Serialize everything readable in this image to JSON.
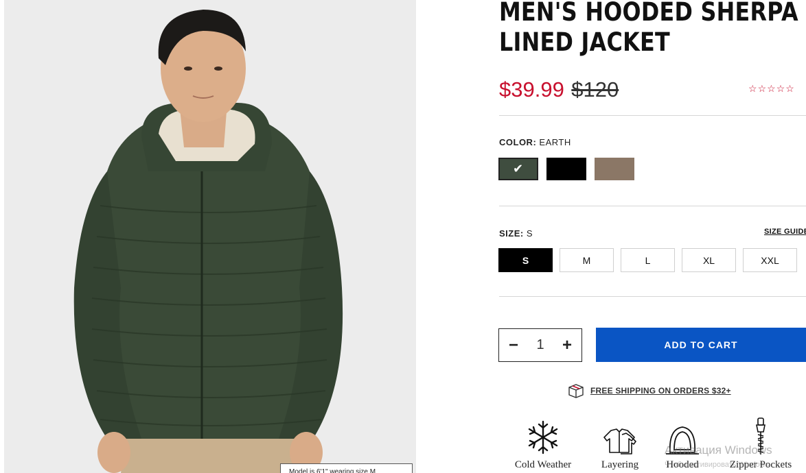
{
  "product": {
    "title": "MEN'S HOODED SHERPA LINED JACKET",
    "title_line1": "MEN'S HOODED SHERPA",
    "title_line2": "LINED JACKET",
    "price_sale": "$39.99",
    "price_original": "$120",
    "rating_stars": 5,
    "rating_value": 0,
    "image_caption": "Model is 6'1\" wearing size M"
  },
  "color": {
    "label": "COLOR:",
    "selected": "EARTH",
    "swatches": [
      {
        "name": "earth",
        "hex": "#3f4d3f",
        "selected": true
      },
      {
        "name": "black",
        "hex": "#000000",
        "selected": false
      },
      {
        "name": "taupe",
        "hex": "#8b7766",
        "selected": false
      }
    ]
  },
  "size": {
    "label": "SIZE:",
    "selected": "S",
    "guide_label": "SIZE GUIDE",
    "options": [
      "S",
      "M",
      "L",
      "XL",
      "XXL"
    ]
  },
  "quantity": {
    "value": "1",
    "minus": "−",
    "plus": "+"
  },
  "cart": {
    "add_label": "ADD TO CART"
  },
  "shipping": {
    "text": "FREE SHIPPING ON ORDERS $32+",
    "icon": "box-icon"
  },
  "features": [
    {
      "label": "Cold Weather",
      "icon": "snowflake-icon"
    },
    {
      "label": "Layering",
      "icon": "layering-icon"
    },
    {
      "label": "Hooded",
      "icon": "hood-icon"
    },
    {
      "label": "Zipper Pockets",
      "icon": "zipper-icon"
    }
  ],
  "os_watermark": {
    "line1": "Активация Windows",
    "line2": "Чтобы активировать Windows"
  },
  "colors": {
    "sale_red": "#c8102e",
    "cart_blue": "#0a55c4",
    "jacket_green": "#3f4d3f"
  }
}
